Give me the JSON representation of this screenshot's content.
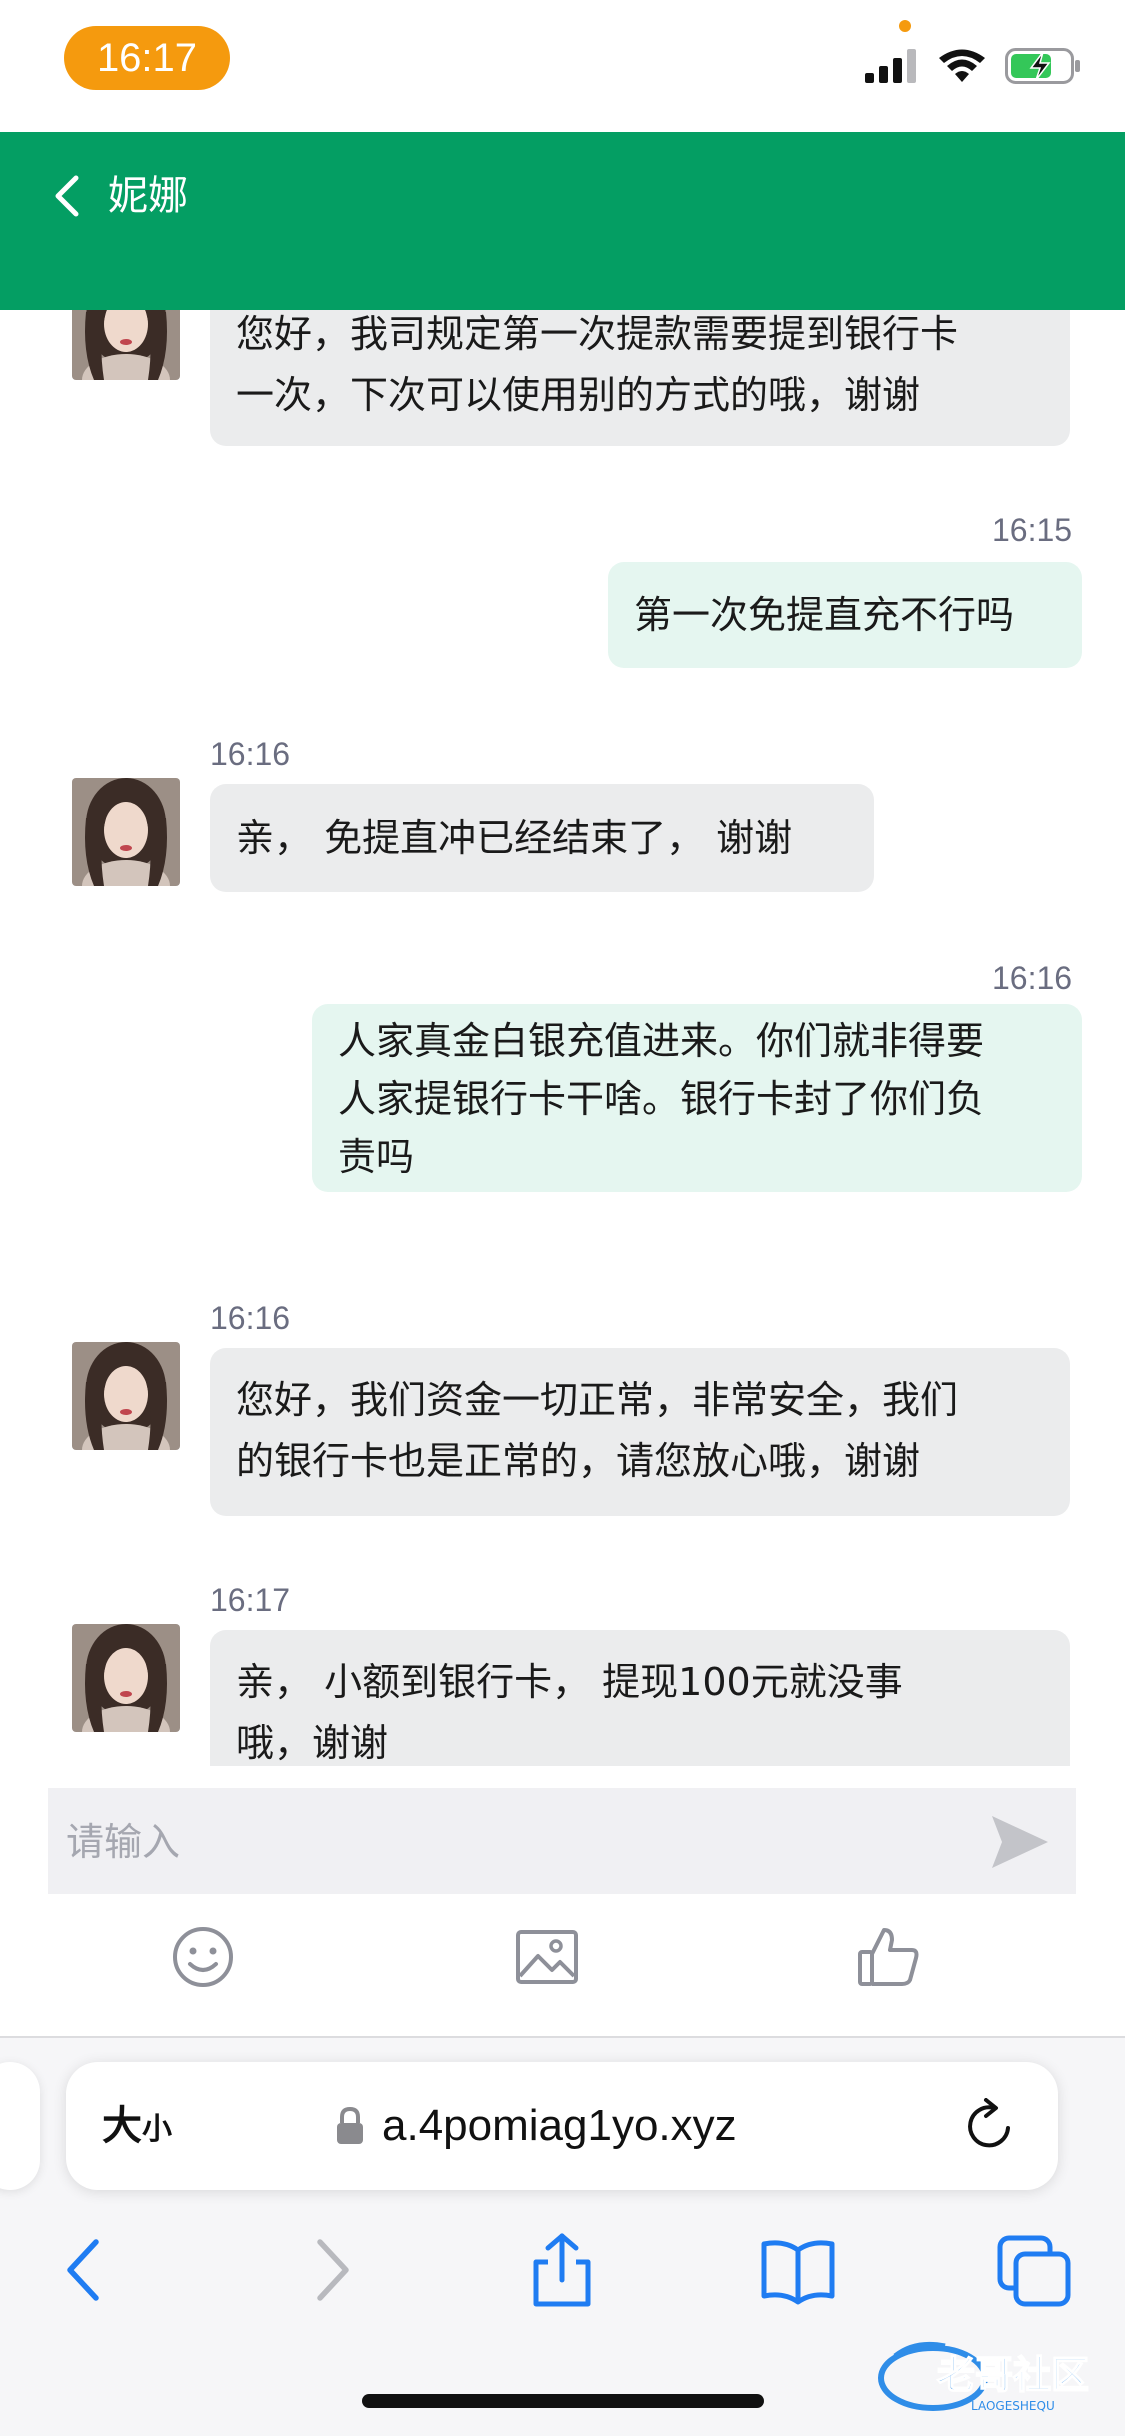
{
  "status_bar": {
    "time": "16:17",
    "icons": [
      "cellular-signal-icon",
      "wifi-icon",
      "battery-charging-icon"
    ],
    "accent": "#f59a0e"
  },
  "header": {
    "title": "妮娜",
    "back_icon": "chevron-left-icon",
    "color": "#049e63"
  },
  "messages": [
    {
      "direction": "incoming",
      "time": "",
      "text": "您好，我司规定第一次提款需要提到银行卡\n一次，下次可以使用别的方式的哦，谢谢"
    },
    {
      "direction": "outgoing",
      "time": "16:15",
      "text": "第一次免提直充不行吗"
    },
    {
      "direction": "incoming",
      "time": "16:16",
      "text": "亲， 免提直冲已经结束了， 谢谢"
    },
    {
      "direction": "outgoing",
      "time": "16:16",
      "text": "人家真金白银充值进来。你们就非得要\n人家提银行卡干啥。银行卡封了你们负\n责吗"
    },
    {
      "direction": "incoming",
      "time": "16:16",
      "text": "您好，我们资金一切正常，非常安全，我们\n的银行卡也是正常的，请您放心哦，谢谢"
    },
    {
      "direction": "incoming",
      "time": "16:17",
      "text": "亲， 小额到银行卡， 提现100元就没事\n哦，谢谢"
    }
  ],
  "input": {
    "placeholder": "请输入",
    "send_icon": "send-icon"
  },
  "toolbar": {
    "icons": [
      "emoji-icon",
      "image-icon",
      "thumbs-up-icon"
    ]
  },
  "browser": {
    "text_size_label_big": "大",
    "text_size_label_small": "小",
    "url": "a.4pomiag1yo.xyz",
    "lock_icon": "lock-icon",
    "reload_icon": "reload-icon",
    "nav_icons": [
      "back-icon",
      "forward-icon",
      "share-icon",
      "bookmarks-icon",
      "tabs-icon"
    ],
    "accent": "#1f7cf2"
  },
  "watermark": {
    "text": "老哥社区",
    "subtext": "LAOGESHEQU"
  }
}
